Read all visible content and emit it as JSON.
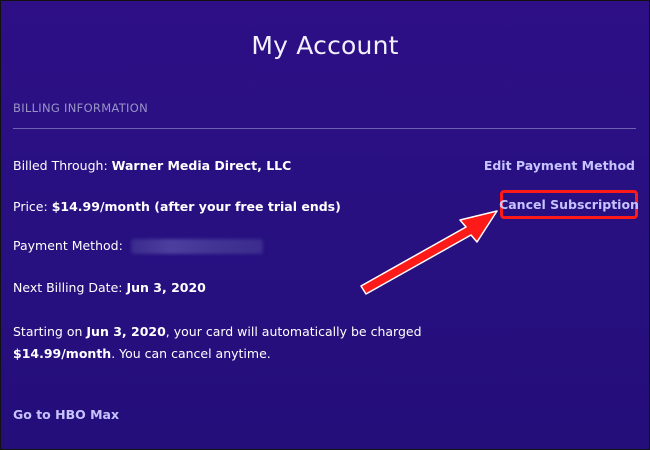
{
  "page": {
    "title": "My Account"
  },
  "billing": {
    "section_heading": "BILLING INFORMATION",
    "billed_through_label": "Billed Through:",
    "billed_through_value": "Warner Media Direct, LLC",
    "price_label": "Price:",
    "price_value": "$14.99/month (after your free trial ends)",
    "payment_method_label": "Payment Method:",
    "next_billing_label": "Next Billing Date:",
    "next_billing_value": "Jun 3, 2020",
    "notice_prefix": "Starting on",
    "notice_date": "Jun 3, 2020",
    "notice_middle": ", your card will automatically be charged",
    "notice_amount": "$14.99/month",
    "notice_suffix": ". You can cancel anytime."
  },
  "actions": {
    "edit_payment_label": "Edit Payment Method",
    "cancel_subscription_label": "Cancel Subscription",
    "go_to_hbo_label": "Go to HBO Max"
  },
  "icons": {
    "annotation": "red-arrow-icon"
  },
  "colors": {
    "background": "#281081",
    "link": "#c6c3ff",
    "highlight": "#ff1a1a",
    "divider": "#6f63b0"
  }
}
